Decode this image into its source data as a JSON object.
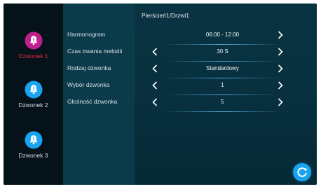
{
  "header": {
    "title": "Pierścień1/Drzwi1"
  },
  "sidebar": {
    "items": [
      {
        "label": "Dzwonek 1",
        "active": true,
        "icon": "bell-icon",
        "color": "#c0208e"
      },
      {
        "label": "Dzwonek 2",
        "active": false,
        "icon": "bell-icon",
        "color": "#1aa3ee"
      },
      {
        "label": "Dzwonek 3",
        "active": false,
        "icon": "bell-icon",
        "color": "#1aa3ee"
      }
    ]
  },
  "settings": {
    "rows": [
      {
        "label": "Harmonogram",
        "value": "06:00 - 12:00"
      },
      {
        "label": "Czas trwania melodii",
        "value": "30 S"
      },
      {
        "label": "Rodzaj dzwonka",
        "value": "Standardowy"
      },
      {
        "label": "Wybór dzwonka",
        "value": "1"
      },
      {
        "label": "Głośność dzwonka",
        "value": "5"
      }
    ]
  },
  "colors": {
    "background": "#062a36",
    "sidebar": "#05121a",
    "active_label": "#e8283c",
    "accent": "#1aa3ee"
  },
  "fab": {
    "icon": "refresh-icon"
  }
}
